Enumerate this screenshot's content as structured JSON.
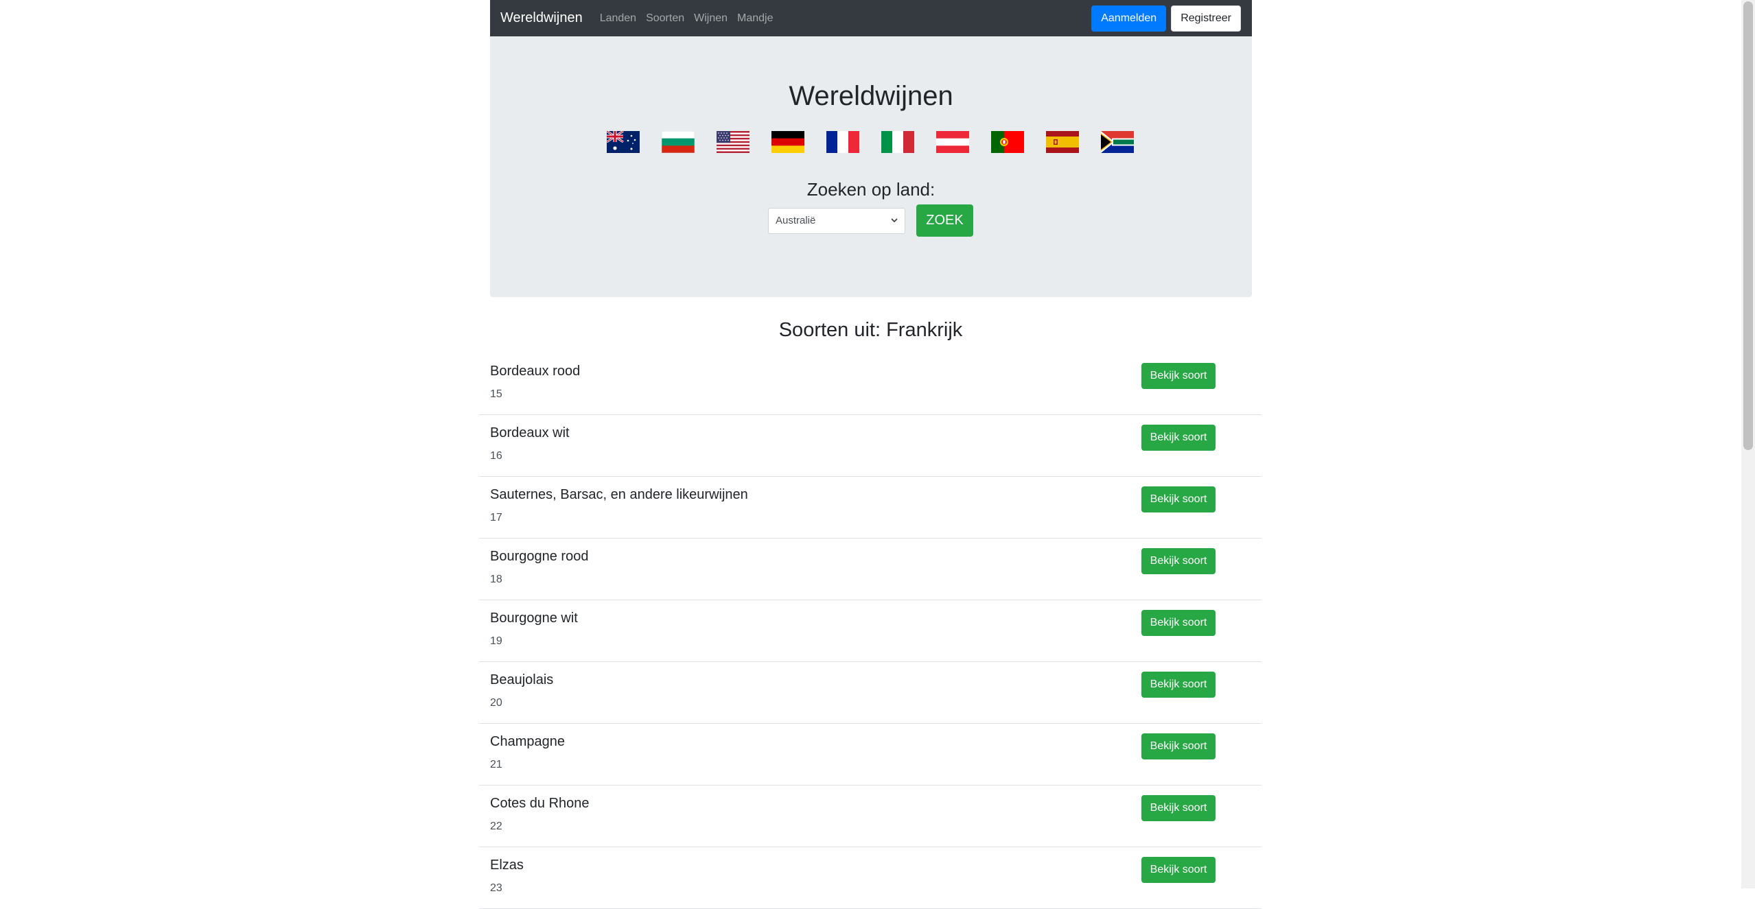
{
  "navbar": {
    "brand": "Wereldwijnen",
    "links": [
      "Landen",
      "Soorten",
      "Wijnen",
      "Mandje"
    ],
    "login_label": "Aanmelden",
    "register_label": "Registreer"
  },
  "hero": {
    "title": "Wereldwijnen",
    "flags": [
      {
        "icon": "australia-flag-icon"
      },
      {
        "icon": "bulgaria-flag-icon"
      },
      {
        "icon": "usa-flag-icon"
      },
      {
        "icon": "germany-flag-icon"
      },
      {
        "icon": "france-flag-icon"
      },
      {
        "icon": "italy-flag-icon"
      },
      {
        "icon": "austria-flag-icon"
      },
      {
        "icon": "portugal-flag-icon"
      },
      {
        "icon": "spain-flag-icon"
      },
      {
        "icon": "south-africa-flag-icon"
      }
    ],
    "search_label": "Zoeken op land:",
    "select_value": "Australië",
    "search_button": "ZOEK"
  },
  "section": {
    "title": "Soorten uit: Frankrijk"
  },
  "soorten": [
    {
      "name": "Bordeaux rood",
      "id": "15",
      "button": "Bekijk soort"
    },
    {
      "name": "Bordeaux wit",
      "id": "16",
      "button": "Bekijk soort"
    },
    {
      "name": "Sauternes, Barsac, en andere likeurwijnen",
      "id": "17",
      "button": "Bekijk soort"
    },
    {
      "name": "Bourgogne rood",
      "id": "18",
      "button": "Bekijk soort"
    },
    {
      "name": "Bourgogne wit",
      "id": "19",
      "button": "Bekijk soort"
    },
    {
      "name": "Beaujolais",
      "id": "20",
      "button": "Bekijk soort"
    },
    {
      "name": "Champagne",
      "id": "21",
      "button": "Bekijk soort"
    },
    {
      "name": "Cotes du Rhone",
      "id": "22",
      "button": "Bekijk soort"
    },
    {
      "name": "Elzas",
      "id": "23",
      "button": "Bekijk soort"
    }
  ],
  "colors": {
    "navbar_bg": "#343a40",
    "primary": "#007bff",
    "success": "#28a745",
    "hero_bg": "#e9ecef"
  }
}
